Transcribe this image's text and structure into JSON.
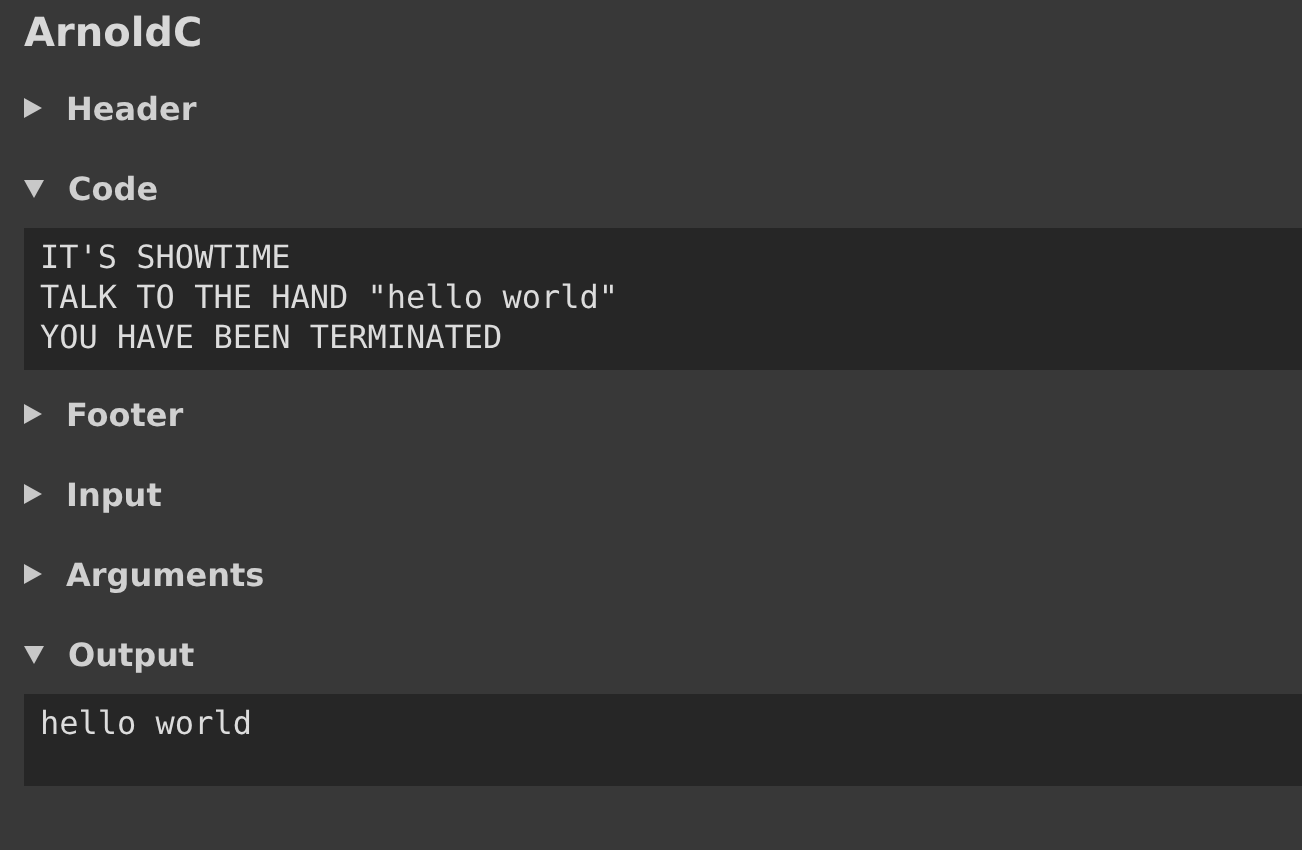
{
  "title": "ArnoldC",
  "sections": [
    {
      "label": "Header",
      "expanded": false
    },
    {
      "label": "Code",
      "expanded": true,
      "lines": [
        "IT'S SHOWTIME",
        "TALK TO THE HAND \"hello world\"",
        "YOU HAVE BEEN TERMINATED"
      ]
    },
    {
      "label": "Footer",
      "expanded": false
    },
    {
      "label": "Input",
      "expanded": false
    },
    {
      "label": "Arguments",
      "expanded": false
    },
    {
      "label": "Output",
      "expanded": true,
      "lines": [
        "hello world"
      ]
    }
  ]
}
